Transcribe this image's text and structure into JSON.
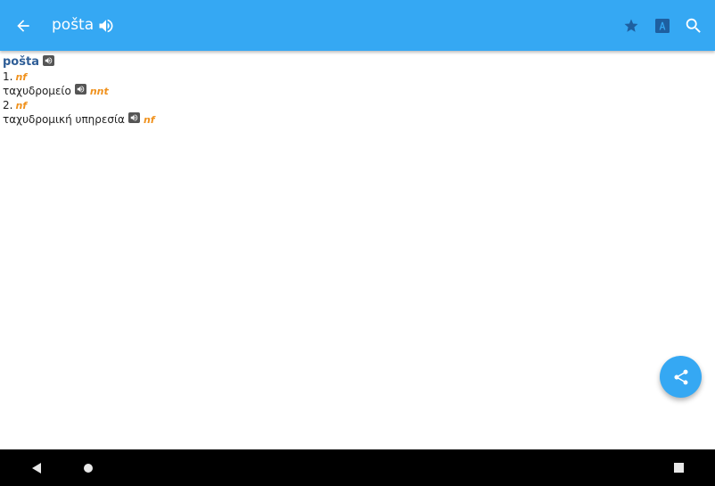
{
  "toolbar": {
    "title": "pošta",
    "background": "#35a8f3",
    "icons": [
      "back-arrow-icon",
      "speaker-icon",
      "star-icon",
      "font-icon",
      "search-icon"
    ]
  },
  "entry": {
    "headword": "pošta",
    "headword_color": "#2f5e97",
    "pos_color": "#f0921e",
    "senses": [
      {
        "number": "1.",
        "pos": "nf",
        "translation": "ταχυδρομείο",
        "translation_pos": "nnt"
      },
      {
        "number": "2.",
        "pos": "nf",
        "translation": "ταχυδρομική υπηρεσία",
        "translation_pos": "nf"
      }
    ]
  },
  "fab": {
    "icon": "share-icon"
  },
  "navbar": {
    "icons": [
      "nav-back-icon",
      "nav-home-icon",
      "nav-recents-icon"
    ]
  }
}
